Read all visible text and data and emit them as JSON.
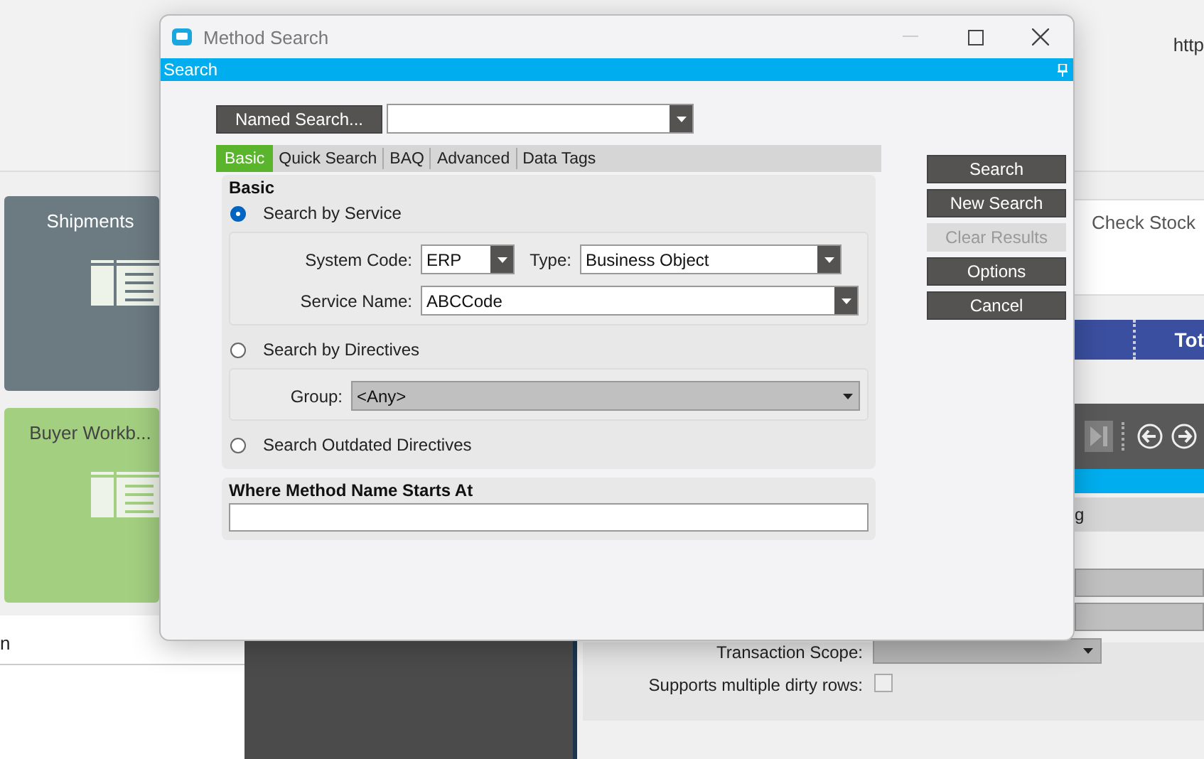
{
  "background_app": {
    "url_fragment": "http",
    "tiles": [
      {
        "title": "Shipments",
        "color": "#6c7a82"
      },
      {
        "title": "Buyer Workb...",
        "color": "#a3cf80"
      }
    ],
    "left_field_label": "n",
    "card_title": "Check Stock",
    "grid_header": "Tot",
    "row_text": "g",
    "transaction_scope": {
      "label": "Transaction Scope:"
    },
    "dirty_rows": {
      "label": "Supports multiple dirty rows:",
      "checked": false
    }
  },
  "dialog": {
    "title": "Method Search",
    "panel_title": "Search",
    "named_search_button": "Named Search...",
    "tabs": [
      {
        "label": "Basic",
        "selected": true
      },
      {
        "label": "Quick Search",
        "selected": false
      },
      {
        "label": "BAQ",
        "selected": false
      },
      {
        "label": "Advanced",
        "selected": false
      },
      {
        "label": "Data Tags",
        "selected": false
      }
    ],
    "section_title": "Basic",
    "options": [
      {
        "label": "Search by Service",
        "selected": true
      },
      {
        "label": "Search by Directives",
        "selected": false
      },
      {
        "label": "Search Outdated Directives",
        "selected": false
      }
    ],
    "system_code": {
      "label": "System Code:",
      "value": "ERP"
    },
    "type": {
      "label": "Type:",
      "value": "Business Object"
    },
    "service_name": {
      "label": "Service Name:",
      "value": "ABCCode"
    },
    "group": {
      "label": "Group:",
      "value": "<Any>",
      "disabled": true
    },
    "where_title": "Where Method Name Starts At",
    "buttons": [
      {
        "label": "Search",
        "disabled": false
      },
      {
        "label": "New Search",
        "disabled": false
      },
      {
        "label": "Clear Results",
        "disabled": true
      },
      {
        "label": "Options",
        "disabled": false
      },
      {
        "label": "Cancel",
        "disabled": false
      }
    ]
  }
}
